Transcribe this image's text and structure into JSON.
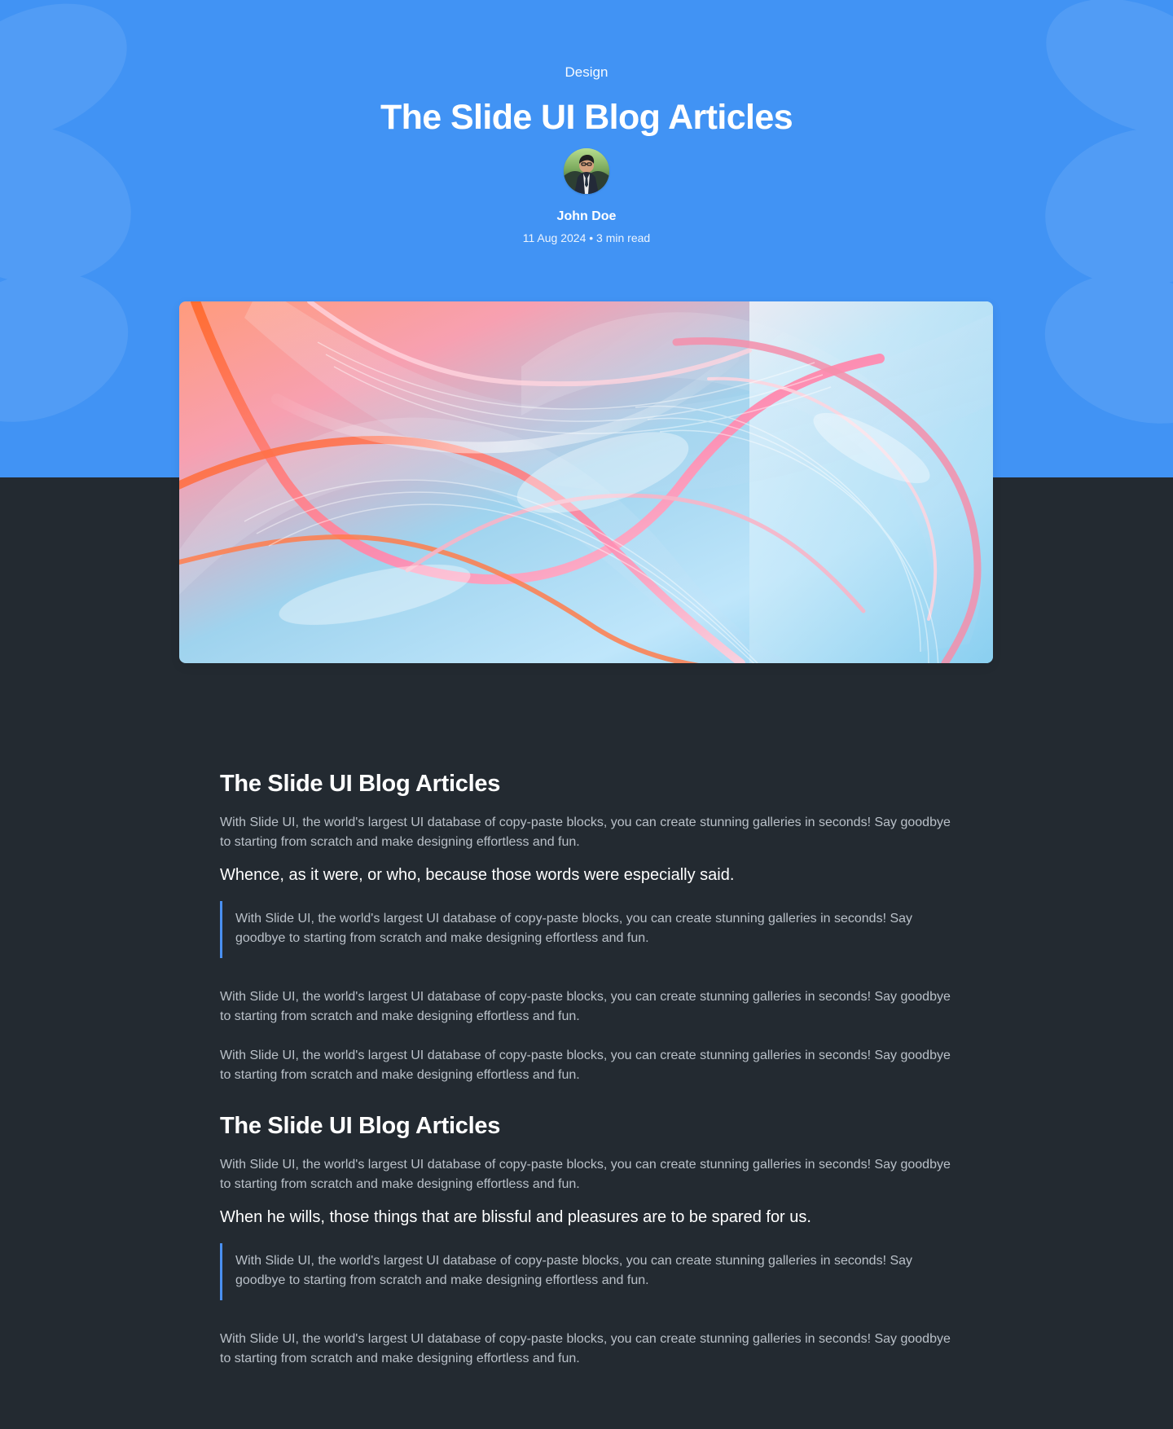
{
  "hero": {
    "category": "Design",
    "title": "The Slide UI Blog Articles",
    "author": "John Doe",
    "meta": "11 Aug 2024 • 3 min read",
    "background_color": "#4193f4"
  },
  "article": {
    "section1_title": "The Slide UI Blog Articles",
    "section1_paragraph": "With Slide UI, the world's largest UI database of copy-paste blocks, you can create stunning galleries in seconds! Say goodbye to starting from scratch and make designing effortless and fun.",
    "section1_subheading": "Whence, as it were, or who, because those words were especially said.",
    "section1_quote": "With Slide UI, the world's largest UI database of copy-paste blocks, you can create stunning galleries in seconds! Say goodbye to starting from scratch and make designing effortless and fun.",
    "section1_paragraph_2": "With Slide UI, the world's largest UI database of copy-paste blocks, you can create stunning galleries in seconds! Say goodbye to starting from scratch and make designing effortless and fun.",
    "section1_paragraph_3": "With Slide UI, the world's largest UI database of copy-paste blocks, you can create stunning galleries in seconds! Say goodbye to starting from scratch and make designing effortless and fun.",
    "section2_title": "The Slide UI Blog Articles",
    "section2_paragraph": "With Slide UI, the world's largest UI database of copy-paste blocks, you can create stunning galleries in seconds! Say goodbye to starting from scratch and make designing effortless and fun.",
    "section2_subheading": "When he wills, those things that are blissful and pleasures are to be spared for us.",
    "section2_quote": "With Slide UI, the world's largest UI database of copy-paste blocks, you can create stunning galleries in seconds! Say goodbye to starting from scratch and make designing effortless and fun.",
    "section2_paragraph_2": "With Slide UI, the world's largest UI database of copy-paste blocks, you can create stunning galleries in seconds! Say goodbye to starting from scratch and make designing effortless and fun."
  },
  "theme": {
    "page_background": "#232a31",
    "body_text": "#b9c0c8",
    "quote_accent": "#4a90f1"
  }
}
